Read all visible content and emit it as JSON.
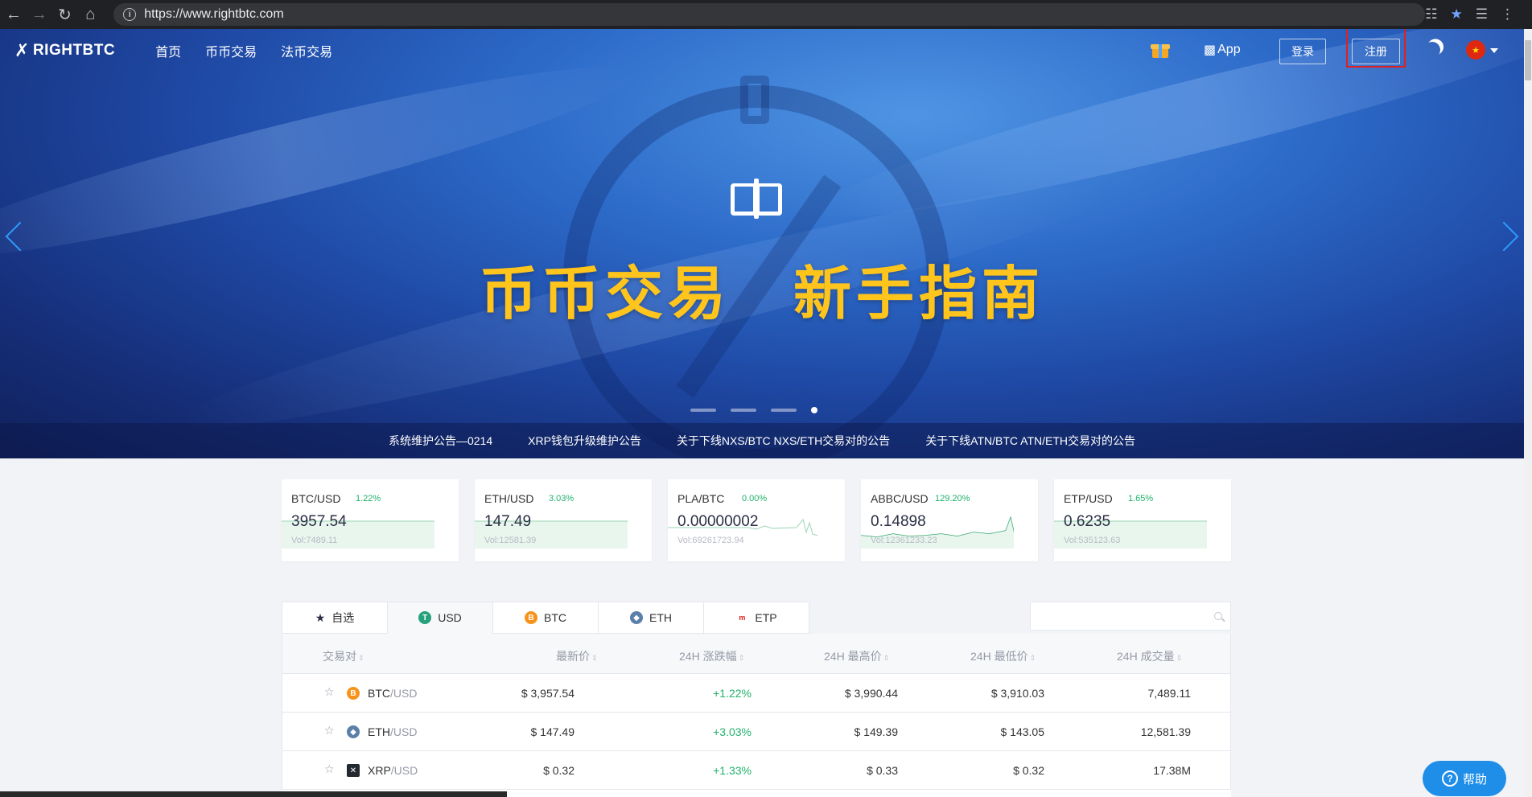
{
  "browser": {
    "url": "https://www.rightbtc.com"
  },
  "nav": {
    "logo": "RIGHTBTC",
    "links": [
      "首页",
      "币币交易",
      "法币交易"
    ],
    "app": "App",
    "login": "登录",
    "register": "注册"
  },
  "hero": {
    "title": "币币交易　新手指南",
    "slides_total": 4,
    "active_slide": 4
  },
  "notices": [
    "系统维护公告—0214",
    "XRP钱包升级维护公告",
    "关于下线NXS/BTC NXS/ETH交易对的公告",
    "关于下线ATN/BTC ATN/ETH交易对的公告"
  ],
  "tickers": [
    {
      "pair": "BTC/USD",
      "change": "1.22%",
      "price": "3957.54",
      "vol": "Vol:7489.11"
    },
    {
      "pair": "ETH/USD",
      "change": "3.03%",
      "price": "147.49",
      "vol": "Vol:12581.39"
    },
    {
      "pair": "PLA/BTC",
      "change": "0.00%",
      "price": "0.00000002",
      "vol": "Vol:69261723.94"
    },
    {
      "pair": "ABBC/USD",
      "change": "129.20%",
      "price": "0.14898",
      "vol": "Vol:12361233.23"
    },
    {
      "pair": "ETP/USD",
      "change": "1.65%",
      "price": "0.6235",
      "vol": "Vol:535123.63"
    }
  ],
  "market": {
    "tabs": [
      "自选",
      "USD",
      "BTC",
      "ETH",
      "ETP"
    ],
    "active_tab": "USD",
    "search_placeholder": "",
    "columns": [
      "交易对",
      "最新价",
      "24H 涨跌幅",
      "24H 最高价",
      "24H 最低价",
      "24H 成交量"
    ],
    "rows": [
      {
        "base": "BTC",
        "quote": "/USD",
        "price": "$ 3,957.54",
        "change": "+1.22%",
        "high": "$ 3,990.44",
        "low": "$ 3,910.03",
        "volume": "7,489.11"
      },
      {
        "base": "ETH",
        "quote": "/USD",
        "price": "$ 147.49",
        "change": "+3.03%",
        "high": "$ 149.39",
        "low": "$ 143.05",
        "volume": "12,581.39"
      },
      {
        "base": "XRP",
        "quote": "/USD",
        "price": "$ 0.32",
        "change": "+1.33%",
        "high": "$ 0.33",
        "low": "$ 0.32",
        "volume": "17.38M"
      }
    ]
  },
  "help": "帮助",
  "colors": {
    "up": "#21b26b",
    "accent": "#1f8ee8",
    "hero_title": "#ffc51c"
  }
}
